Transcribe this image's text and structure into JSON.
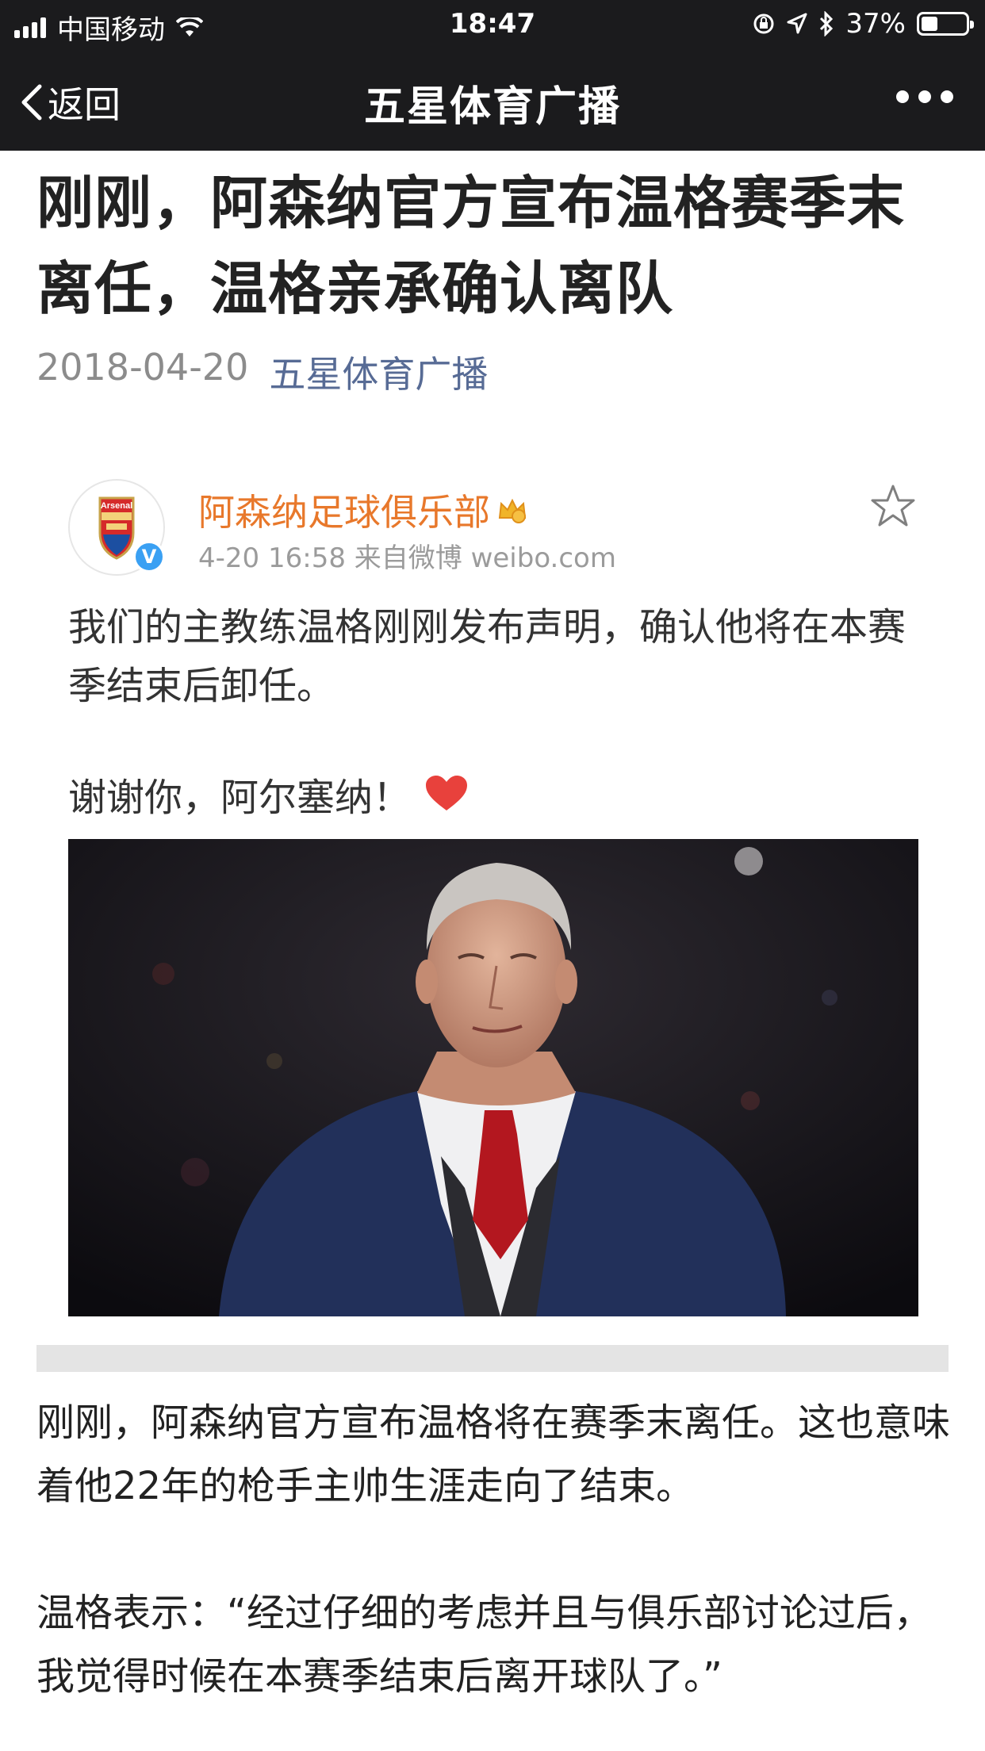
{
  "status_bar": {
    "carrier": "中国移动",
    "time": "18:47",
    "battery": "37%",
    "battery_level": 0.37
  },
  "nav": {
    "back_label": "返回",
    "title": "五星体育广播"
  },
  "article": {
    "title": "刚刚，阿森纳官方宣布温格赛季末离任，温格亲承确认离队",
    "date": "2018-04-20",
    "author": "五星体育广播"
  },
  "weibo": {
    "account_name": "阿森纳足球俱乐部",
    "avatar_text": "Arsenal",
    "time_source": "4-20 16:58  来自微博 weibo.com",
    "text": "我们的主教练温格刚刚发布声明，确认他将在本赛季结束后卸任。",
    "thanks": "谢谢你，阿尔塞纳！"
  },
  "body": {
    "paragraph1": "刚刚，阿森纳官方宣布温格将在赛季末离任。这也意味着他22年的枪手主帅生涯走向了结束。",
    "paragraph2": "温格表示：“经过仔细的考虑并且与俱乐部讨论过后，我觉得时候在本赛季结束后离开球队了。”"
  },
  "colors": {
    "bar_background": "#1b1b1d",
    "link_blue": "#576b95",
    "weibo_orange": "#e8782b",
    "heart_red": "#e8413c"
  }
}
